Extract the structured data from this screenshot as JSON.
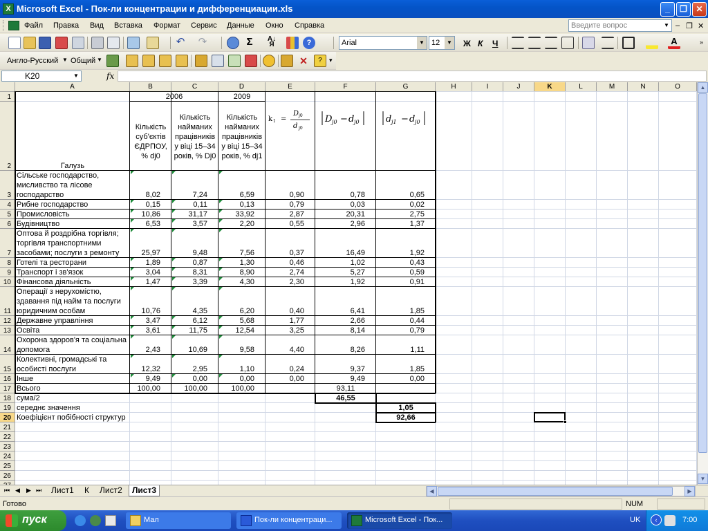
{
  "window": {
    "title": "Microsoft Excel - Пок-ли концентрации и дифференциации.xls"
  },
  "menu": {
    "items": [
      "Файл",
      "Правка",
      "Вид",
      "Вставка",
      "Формат",
      "Сервис",
      "Данные",
      "Окно",
      "Справка"
    ],
    "ask_placeholder": "Введите вопрос"
  },
  "format_toolbar": {
    "font": "Arial",
    "size": "12",
    "bold": "Ж",
    "italic": "К",
    "underline": "Ч"
  },
  "lang_toolbar": {
    "language": "Англо-Русский",
    "mode": "Общий"
  },
  "formula_bar": {
    "name_box": "K20",
    "fx": "fx",
    "formula": ""
  },
  "columns": [
    "A",
    "B",
    "C",
    "D",
    "E",
    "F",
    "G",
    "H",
    "I",
    "J",
    "K",
    "L",
    "M",
    "N",
    "O"
  ],
  "rows": [
    "1",
    "2",
    "3",
    "4",
    "5",
    "6",
    "7",
    "8",
    "9",
    "10",
    "11",
    "12",
    "13",
    "14",
    "15",
    "16",
    "17",
    "18",
    "19",
    "20",
    "21",
    "22",
    "23",
    "24",
    "25",
    "26",
    "27"
  ],
  "sheet": {
    "year_2006": "2006",
    "year_2009": "2009",
    "header_a": "Галузь",
    "header_b": "Кількість суб'єктів ЄДРПОУ, % dj0",
    "header_c": "Кількість найманих працівників у віці 15–34 років, % Dj0",
    "header_d": "Кількість найманих працівників у віці 15–34 років, % dj1",
    "formula_e": "k_i = D_j0 / d_j0",
    "formula_f": "|D_j0 − d_j0|",
    "formula_g": "|d_j1 − d_j0|",
    "data": [
      {
        "name": "Сільське господарство, мисливство та лісове господарство",
        "b": "8,02",
        "c": "7,24",
        "d": "6,59",
        "e": "0,90",
        "f": "0,78",
        "g": "0,65"
      },
      {
        "name": "Рибне господарство",
        "b": "0,15",
        "c": "0,11",
        "d": "0,13",
        "e": "0,79",
        "f": "0,03",
        "g": "0,02"
      },
      {
        "name": "Промисловість",
        "b": "10,86",
        "c": "31,17",
        "d": "33,92",
        "e": "2,87",
        "f": "20,31",
        "g": "2,75"
      },
      {
        "name": "Будівництво",
        "b": "6,53",
        "c": "3,57",
        "d": "2,20",
        "e": "0,55",
        "f": "2,96",
        "g": "1,37"
      },
      {
        "name": "Оптова й роздрібна торгівля; торгівля транспортними засобами; послуги з ремонту",
        "b": "25,97",
        "c": "9,48",
        "d": "7,56",
        "e": "0,37",
        "f": "16,49",
        "g": "1,92"
      },
      {
        "name": "Готелі та ресторани",
        "b": "1,89",
        "c": "0,87",
        "d": "1,30",
        "e": "0,46",
        "f": "1,02",
        "g": "0,43"
      },
      {
        "name": "Транспорт і зв'язок",
        "b": "3,04",
        "c": "8,31",
        "d": "8,90",
        "e": "2,74",
        "f": "5,27",
        "g": "0,59"
      },
      {
        "name": "Фінансова діяльність",
        "b": "1,47",
        "c": "3,39",
        "d": "4,30",
        "e": "2,30",
        "f": "1,92",
        "g": "0,91"
      },
      {
        "name": "Операції з нерухомістю, здавання під найм та послуги юридичним особам",
        "b": "10,76",
        "c": "4,35",
        "d": "6,20",
        "e": "0,40",
        "f": "6,41",
        "g": "1,85"
      },
      {
        "name": "Державне управління",
        "b": "3,47",
        "c": "6,12",
        "d": "5,68",
        "e": "1,77",
        "f": "2,66",
        "g": "0,44"
      },
      {
        "name": "Освіта",
        "b": "3,61",
        "c": "11,75",
        "d": "12,54",
        "e": "3,25",
        "f": "8,14",
        "g": "0,79"
      },
      {
        "name": "Охорона здоров'я та соціальна допомога",
        "b": "2,43",
        "c": "10,69",
        "d": "9,58",
        "e": "4,40",
        "f": "8,26",
        "g": "1,11"
      },
      {
        "name": "Колективні, громадські та особисті послуги",
        "b": "12,32",
        "c": "2,95",
        "d": "1,10",
        "e": "0,24",
        "f": "9,37",
        "g": "1,85"
      },
      {
        "name": "Інше",
        "b": "9,49",
        "c": "0,00",
        "d": "0,00",
        "e": "0,00",
        "f": "9,49",
        "g": "0,00"
      },
      {
        "name": "Всього",
        "b": "100,00",
        "c": "100,00",
        "d": "100,00",
        "e": "",
        "f": "93,11",
        "g": ""
      }
    ],
    "sum_half_label": "сума/2",
    "sum_half_value": "46,55",
    "mean_label": "середнє значення",
    "mean_value": "1,05",
    "coef_label": "Коефіцієнт побібності структур",
    "coef_value": "92,66"
  },
  "tabs": [
    "Лист1",
    "К",
    "Лист2",
    "Лист3"
  ],
  "status": {
    "ready": "Готово",
    "num": "NUM"
  },
  "taskbar": {
    "start": "пуск",
    "tasks": [
      "Мал",
      "Пок-ли концентраци...",
      "Microsoft Excel - Пок..."
    ],
    "lang": "UK",
    "time": "7:00"
  }
}
